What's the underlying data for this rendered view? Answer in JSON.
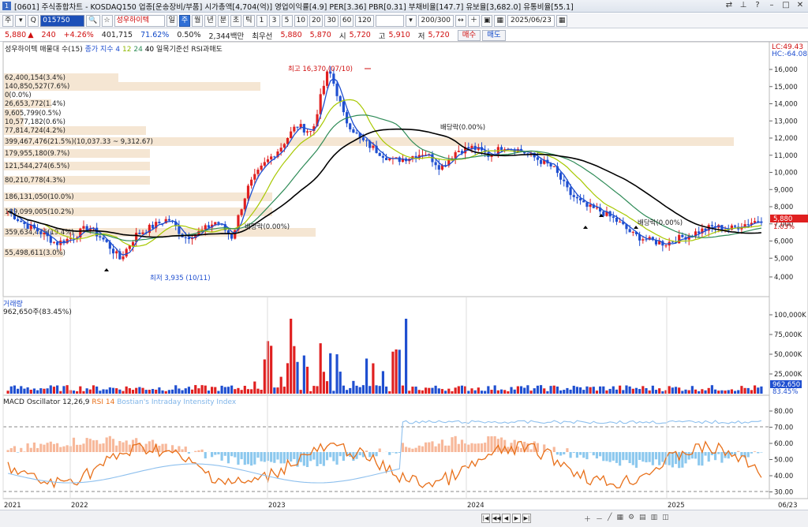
{
  "window": {
    "title": "[0601] 주식종합차트 - KOSDAQ150 업종[운송장비/부품] 시가총액[4,704(억)] 영업이익률[4.9] PER[3.36] PBR[0.31] 부채비율[147.7] 유보율[3,682.0] 유통비율[55.1]",
    "icon_label": "1"
  },
  "toolbar": {
    "period_label": "주",
    "code_value": "015750",
    "stock_name": "성우하이텍",
    "period_buttons": [
      "일",
      "주",
      "월",
      "년",
      "분",
      "초",
      "틱"
    ],
    "interval_buttons": [
      "1",
      "3",
      "5",
      "10",
      "20",
      "30",
      "60",
      "120"
    ],
    "count_value": "200/300",
    "date_value": "2025/06/23"
  },
  "quote": {
    "price": "5,880",
    "change": "240",
    "change_pct": "+4.26%",
    "volume": "401,715",
    "vol_ratio": "71.62%",
    "turnover": "0.50%",
    "amount": "2,344백만",
    "best_ask_label": "최우선",
    "best_ask": "5,880",
    "best_bid": "5,870",
    "open_label": "시",
    "open": "5,720",
    "high_label": "고",
    "high": "5,910",
    "low_label": "저",
    "low": "5,720",
    "buy_label": "매수",
    "sell_label": "매도"
  },
  "price_panel": {
    "legend": "성우하이텍 매물대 수(15)",
    "legend2": "종가 지수 4",
    "ma_labels": [
      "12",
      "24",
      "40"
    ],
    "legend3": "일목기준선",
    "legend4": "RSI과매도",
    "lc_label": "LC:49.43",
    "hc_label": "HC:-64.08",
    "price_tag": "5,880",
    "pct_tag": "1.03%",
    "high_annotation": "최고 16,370 (07/10)",
    "low_annotation": "최저 3,935 (10/11)",
    "dividend_label": "배당락(0.00%)",
    "volume_profile": [
      "62,400,154(3.4%)",
      "140,850,527(7.6%)",
      "0(0.0%)",
      "26,653,772(1.4%)",
      "9,605,799(0.5%)",
      "10,577,182(0.6%)",
      "77,814,724(4.2%)",
      "399,467,476(21.5%)(10,037.33 ~ 9,312.67)",
      "179,955,180(9.7%)",
      "121,544,274(6.5%)",
      "80,210,778(4.3%)",
      "186,131,050(10.0%)",
      "189,099,005(10.2%)",
      "359,634,475(19.4%)",
      "55,498,611(3.0%)"
    ],
    "y_ticks": [
      "16,000",
      "15,000",
      "14,000",
      "13,000",
      "12,000",
      "11,000",
      "10,000",
      "9,000",
      "8,000",
      "7,000",
      "6,000",
      "5,000",
      "4,000"
    ]
  },
  "volume_panel": {
    "legend": "거래량",
    "last_value": "962,650주(83.45%)",
    "y_ticks": [
      "100,000K",
      "75,000K",
      "50,000K",
      "25,000K"
    ],
    "tag_value": "962,650",
    "tag_pct": "83.45%"
  },
  "indicator_panel": {
    "legend_macd": "MACD Oscillator 12,26,9",
    "legend_rsi": "RSI 14",
    "legend_bostian": "Bostian's Intraday Intensity Index",
    "y_ticks": [
      "80.00",
      "70.00",
      "60.00",
      "50.00",
      "40.00",
      "30.00"
    ]
  },
  "x_axis": {
    "labels": [
      "2021",
      "2022",
      "2023",
      "2024",
      "2025",
      "06/23"
    ]
  },
  "colors": {
    "up": "#e02020",
    "down": "#1f4fd0",
    "profile": "#f5e6d3"
  }
}
